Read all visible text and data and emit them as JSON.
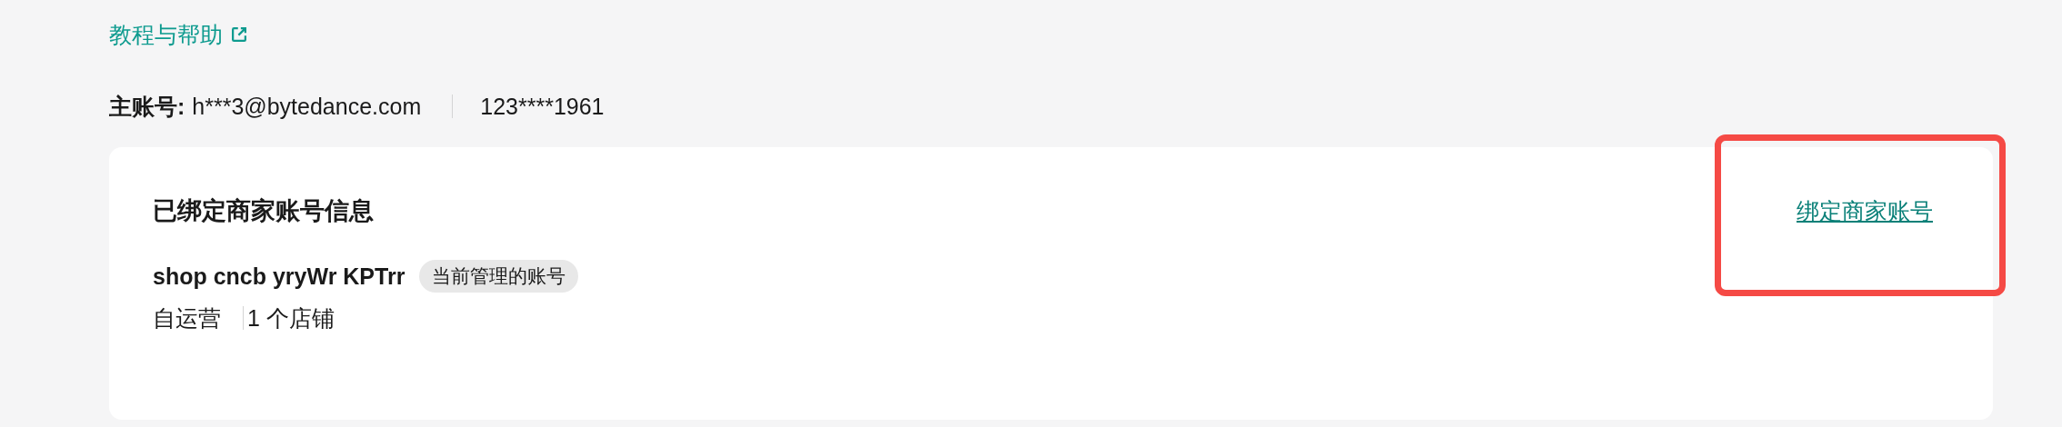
{
  "help_link": {
    "label": "教程与帮助"
  },
  "main_account": {
    "label": "主账号:",
    "email": "h***3@bytedance.com",
    "phone": "123****1961"
  },
  "card": {
    "title": "已绑定商家账号信息",
    "action_link": "绑定商家账号",
    "highlighted": true,
    "accounts": [
      {
        "name": "shop cncb yryWr KPTrr",
        "badge": "当前管理的账号",
        "type": "自运营",
        "shops": "1 个店铺"
      }
    ]
  }
}
